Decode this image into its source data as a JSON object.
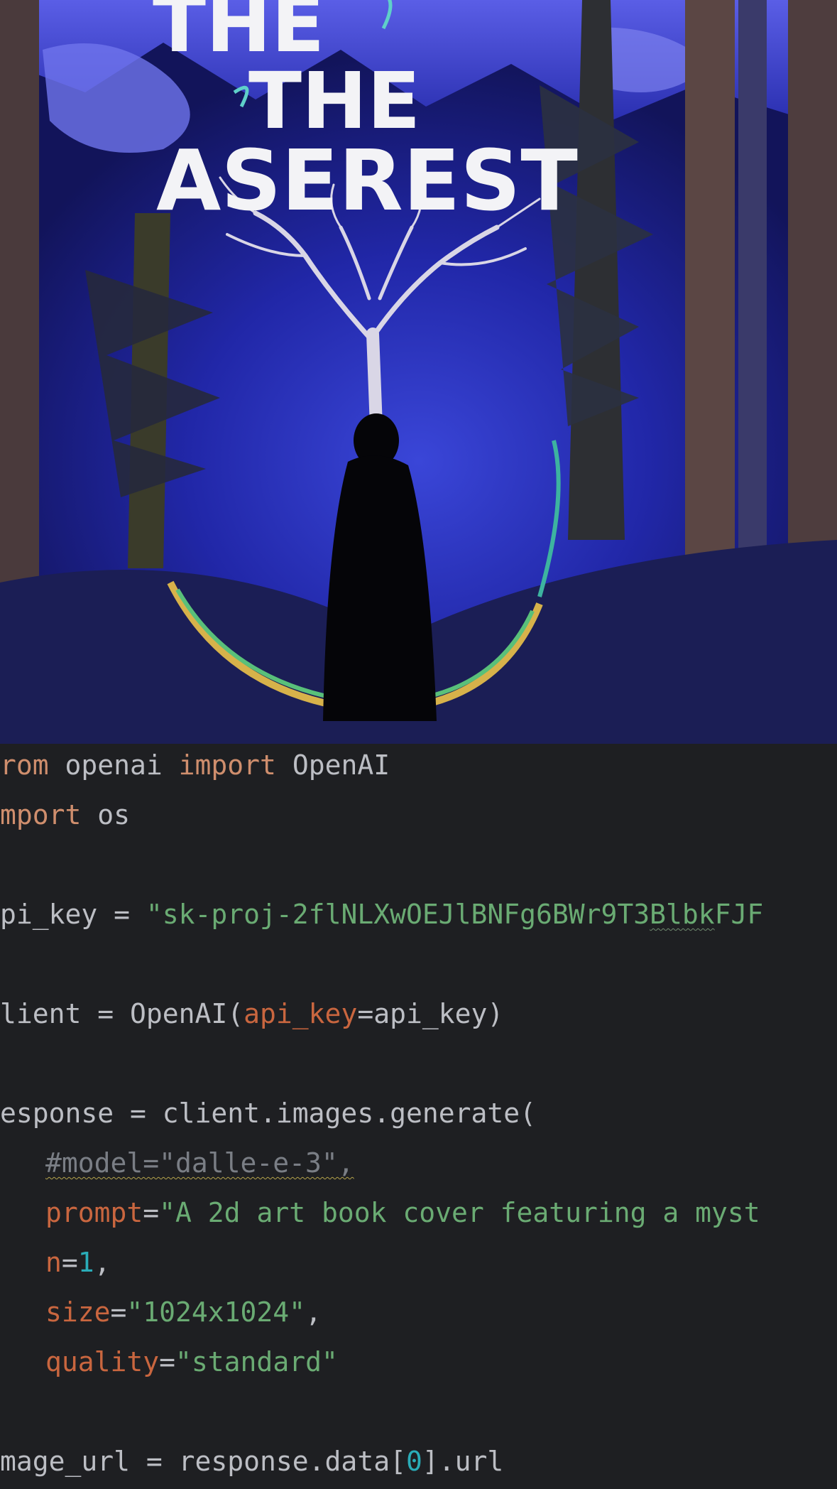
{
  "cover": {
    "title_line1": "THE",
    "title_line2": "THE",
    "title_line3": "ASEREST"
  },
  "code": {
    "line1": {
      "kw1": "rom",
      "mod": " openai ",
      "kw2": "import",
      "cls": " OpenAI"
    },
    "line2": {
      "kw": "mport",
      "rest": " os"
    },
    "line3": {
      "lhs": "pi_key = ",
      "str_a": "\"sk-proj-2flNLXwOEJlBNFg6BWr9T3",
      "str_b": "Blbk",
      "str_c": "FJF"
    },
    "line4": {
      "lhs": "lient = OpenAI(",
      "param": "api_key",
      "rest": "=api_key)"
    },
    "line5": {
      "text": "esponse = client.images.generate("
    },
    "line6": {
      "comment": "#model=\"dalle-e-3\","
    },
    "line7": {
      "param": "prompt",
      "eq": "=",
      "str": "\"A 2d art book cover featuring a myst"
    },
    "line8": {
      "param": "n",
      "eq": "=",
      "num": "1",
      "rest": ","
    },
    "line9": {
      "param": "size",
      "eq": "=",
      "str": "\"1024x1024\"",
      "rest": ","
    },
    "line10": {
      "param": "quality",
      "eq": "=",
      "str": "\"standard\""
    },
    "line11": {
      "lhs": "mage_url = response.data[",
      "num": "0",
      "rest": "].url"
    }
  },
  "colors": {
    "editor_bg": "#1e1f22",
    "keyword": "#cf8e6d",
    "string": "#6aab73",
    "number": "#2aacb8",
    "parameter": "#c9663f",
    "comment": "#7a7e85",
    "default_text": "#bcbec4"
  }
}
